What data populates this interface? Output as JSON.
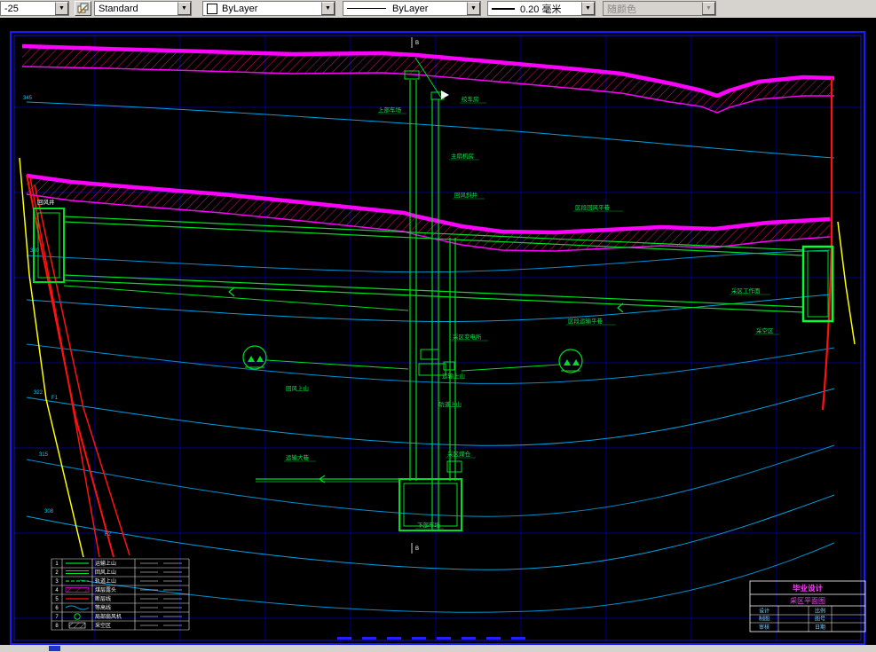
{
  "toolbar": {
    "layer": {
      "value": "-25"
    },
    "text_style": {
      "value": "Standard"
    },
    "color": {
      "value": "ByLayer"
    },
    "linetype": {
      "value": "ByLayer"
    },
    "lineweight": {
      "value": "0.20 毫米"
    },
    "plot_style": {
      "value": "随颜色",
      "disabled": true
    }
  },
  "drawing": {
    "section_marker": "B",
    "labels": {
      "upper_yard": "上部车场",
      "winch_house": "绞车房",
      "main_fan": "主扇机房",
      "return_incline": "回风斜井",
      "district_return": "区段回风平巷",
      "district_haulage": "区段运输平巷",
      "working_face": "采区工作面",
      "goaf": "采空区",
      "substation": "采区变电所",
      "haulage_rise": "运输上山",
      "return_rise": "回风上山",
      "track_rise": "轨道上山",
      "main_haulage": "运输大巷",
      "coal_bunker": "采区煤仓",
      "lower_yard": "下部车场",
      "return_shaft": "回风井"
    },
    "contour_labels": [
      "345",
      "330",
      "322",
      "315",
      "308"
    ],
    "fault_labels": [
      "F1",
      "F2"
    ]
  },
  "legend": {
    "rows": [
      {
        "no": "1",
        "name": "运输上山"
      },
      {
        "no": "2",
        "name": "回风上山"
      },
      {
        "no": "3",
        "name": "轨道上山"
      },
      {
        "no": "4",
        "name": "煤层露头"
      },
      {
        "no": "5",
        "name": "断层线"
      },
      {
        "no": "6",
        "name": "等高线"
      },
      {
        "no": "7",
        "name": "局部扇风机"
      },
      {
        "no": "8",
        "name": "采空区"
      }
    ]
  },
  "title_block": {
    "project": "毕业设计",
    "drawing_title": "采区平面图",
    "fields": [
      "设计",
      "制图",
      "审核",
      "比例",
      "图号",
      "日期"
    ]
  }
}
